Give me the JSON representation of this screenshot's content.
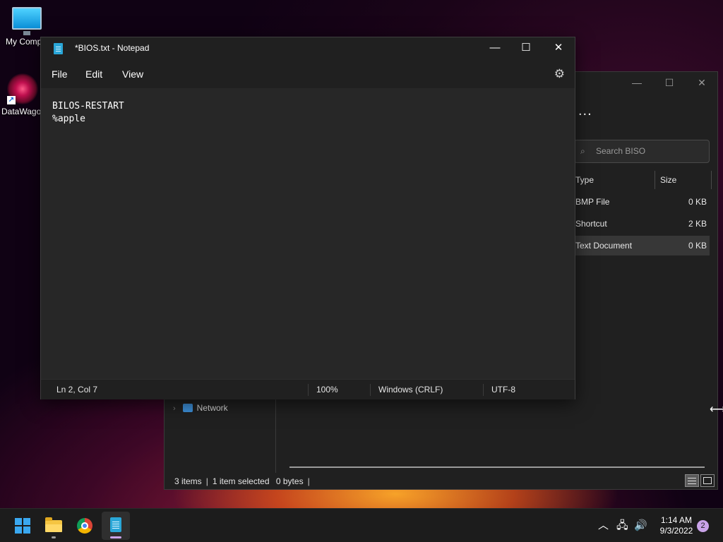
{
  "desktop": {
    "icons": [
      {
        "label": "My Compu",
        "icon": "monitor-icon"
      },
      {
        "label": "DataWago",
        "icon": "datawagon-icon"
      }
    ]
  },
  "explorer": {
    "search_placeholder": "Search BISO",
    "more_label": "...",
    "columns": {
      "type": "Type",
      "size": "Size"
    },
    "rows": [
      {
        "type": "BMP File",
        "size": "0 KB"
      },
      {
        "type": "Shortcut",
        "size": "2 KB"
      },
      {
        "type": "Text Document",
        "size": "0 KB"
      }
    ],
    "nav": {
      "network": "Network"
    },
    "status": {
      "items": "3 items",
      "selected": "1 item selected",
      "bytes": "0 bytes"
    }
  },
  "notepad": {
    "title": "*BIOS.txt - Notepad",
    "menu": {
      "file": "File",
      "edit": "Edit",
      "view": "View"
    },
    "content_lines": [
      "BILOS-RESTART",
      "%apple"
    ],
    "status": {
      "position": "Ln 2, Col 7",
      "zoom": "100%",
      "line_ending": "Windows (CRLF)",
      "encoding": "UTF-8"
    }
  },
  "taskbar": {
    "apps": [
      "start-button",
      "file-explorer",
      "chrome",
      "notepad"
    ],
    "time": "1:14 AM",
    "date": "9/3/2022",
    "notification_count": "2"
  }
}
